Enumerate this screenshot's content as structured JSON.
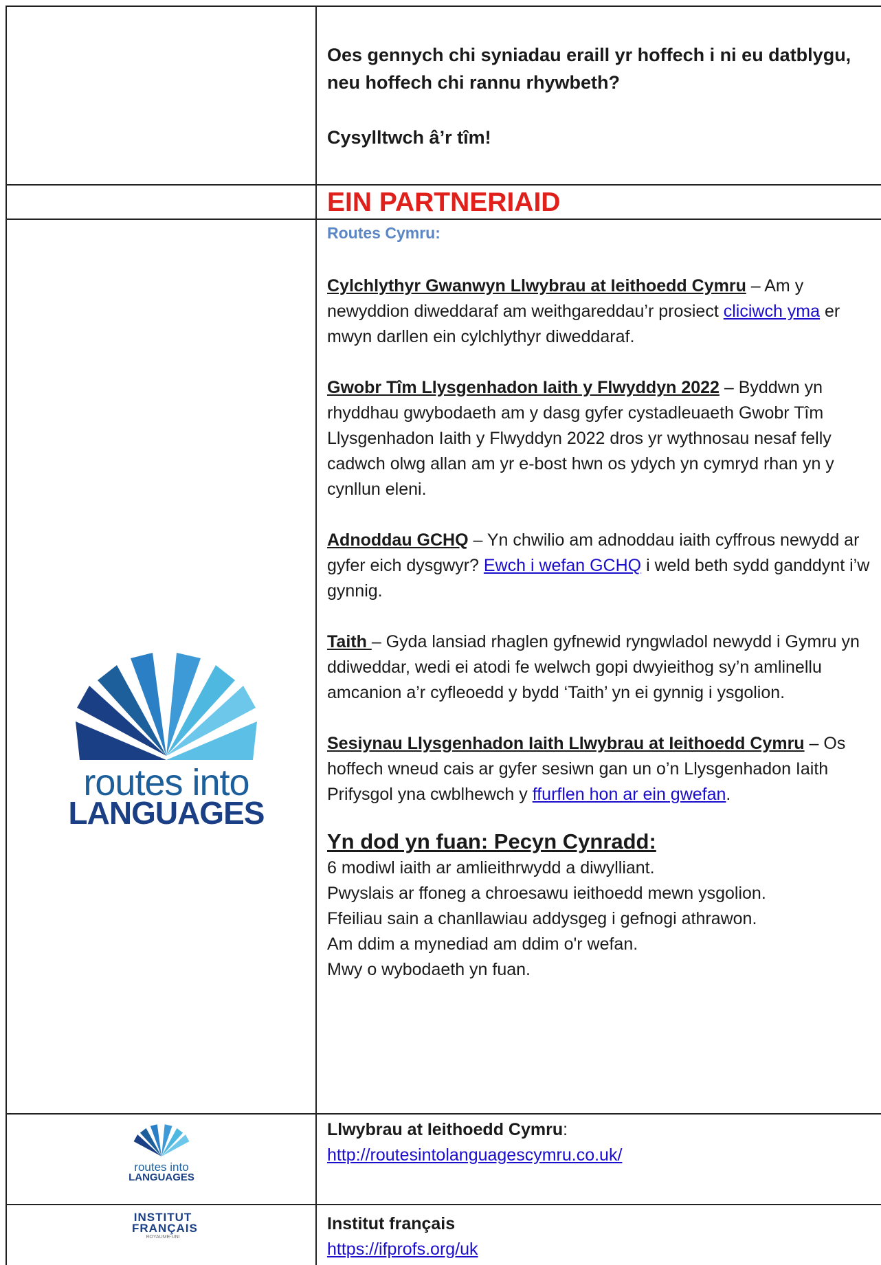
{
  "top_cell": {
    "question": "Oes gennych chi syniadau eraill yr hoffech i ni eu datblygu, neu hoffech chi rannu rhywbeth?",
    "contact": "Cysylltwch â’r tîm!"
  },
  "partners_heading": "EIN PARTNERIAID",
  "routes_cymru": {
    "title": "Routes Cymru:",
    "newsletter": {
      "title": "Cylchlythyr Gwanwyn Llwybrau at Ieithoedd Cymru",
      "text_before": " – Am y newyddion diweddaraf am weithgareddau’r prosiect ",
      "link": "cliciwch yma",
      "text_after": " er mwyn darllen ein cylchlythyr diweddaraf."
    },
    "award": {
      "title": "Gwobr Tîm Llysgenhadon Iaith y Flwyddyn 2022",
      "text": " – Byddwn yn rhyddhau gwybodaeth am y dasg gyfer cystadleuaeth Gwobr Tîm Llysgenhadon Iaith y Flwyddyn 2022 dros yr wythnosau nesaf felly cadwch olwg allan am yr e-bost hwn os ydych yn cymryd rhan yn y cynllun eleni."
    },
    "gchq": {
      "title": "Adnoddau GCHQ",
      "text_before": " – Yn chwilio am adnoddau iaith cyffrous newydd ar gyfer eich dysgwyr?  ",
      "link": "Ewch i wefan GCHQ",
      "text_after": " i weld beth sydd ganddynt i’w gynnig."
    },
    "taith": {
      "title": "Taith ",
      "text": "– Gyda lansiad rhaglen gyfnewid ryngwladol newydd i Gymru yn ddiweddar, wedi ei atodi fe welwch gopi dwyieithog sy’n amlinellu amcanion a’r cyfleoedd y bydd ‘Taith’ yn ei gynnig i ysgolion."
    },
    "sessions": {
      "title": "Sesiynau Llysgenhadon Iaith Llwybrau at Ieithoedd Cymru",
      "text_before": " – Os hoffech wneud cais ar gyfer sesiwn gan un o’n Llysgenhadon Iaith Prifysgol yna cwblhewch y ",
      "link": "ffurflen hon ar ein gwefan",
      "text_after": "."
    },
    "coming_soon": {
      "title": "Yn dod yn fuan: Pecyn Cynradd:",
      "lines": [
        "6 modiwl iaith ar amlieithrwydd a diwylliant.",
        "Pwyslais ar ffoneg a chroesawu ieithoedd mewn ysgolion.",
        "Ffeiliau sain a chanllawiau addysgeg i gefnogi athrawon.",
        "Am ddim a mynediad am ddim o'r wefan.",
        "Mwy o wybodaeth yn fuan."
      ]
    },
    "logo": {
      "line1": "routes into",
      "line2": "LANGUAGES"
    }
  },
  "llwybrau": {
    "title": "Llwybrau at Ieithoedd Cymru",
    "colon": ":",
    "url": "http://routesintolanguagescymru.co.uk/",
    "logo": {
      "line1": "routes into",
      "line2": "LANGUAGES"
    }
  },
  "institut": {
    "title": "Institut français",
    "url": "https://ifprofs.org/uk",
    "logo": {
      "line1": "INSTITUT",
      "line2": "FRANÇAIS",
      "line3": "ROYAUME-UNI"
    }
  },
  "colors": {
    "red_heading": "#e0201b",
    "blue_title": "#5b86c4",
    "link": "#1a0dcc",
    "logo_dark": "#1a3f85",
    "logo_light": "#4fb8e0"
  }
}
